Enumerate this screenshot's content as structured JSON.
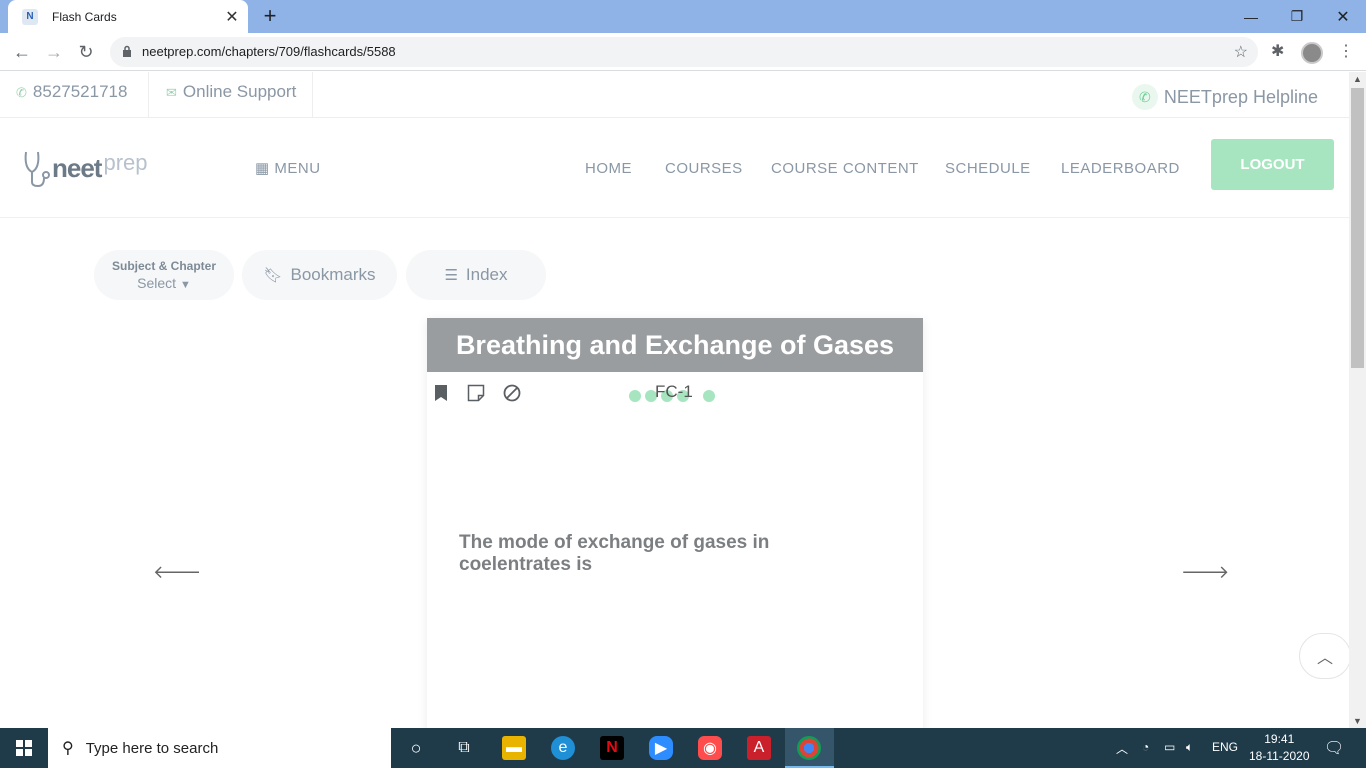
{
  "browser": {
    "tab_title": "Flash Cards",
    "tab_favicon": "N",
    "url": "neetprep.com/chapters/709/flashcards/5588"
  },
  "topbar": {
    "phone": "8527521718",
    "support": "Online Support",
    "helpline": "NEETprep Helpline"
  },
  "header": {
    "logo_main": "neet",
    "logo_sub": "prep",
    "menu_label": "MENU",
    "nav": [
      "HOME",
      "COURSES",
      "COURSE CONTENT",
      "SCHEDULE",
      "LEADERBOARD"
    ],
    "logout": "LOGOUT"
  },
  "filters": {
    "subject_label": "Subject & Chapter",
    "subject_value": "Select",
    "bookmarks": "Bookmarks",
    "index": "Index"
  },
  "card": {
    "title": "Breathing and Exchange of Gases",
    "code": "FC-1",
    "question": "The mode of exchange of gases in coelentrates is"
  },
  "taskbar": {
    "search_placeholder": "Type here to search",
    "lang": "ENG",
    "time": "19:41",
    "date": "18-11-2020"
  },
  "colors": {
    "accent_green": "#a6e5c0",
    "card_header": "#999d9f",
    "tab_bar": "#8fb3e6",
    "taskbar": "#1f3b4a"
  }
}
